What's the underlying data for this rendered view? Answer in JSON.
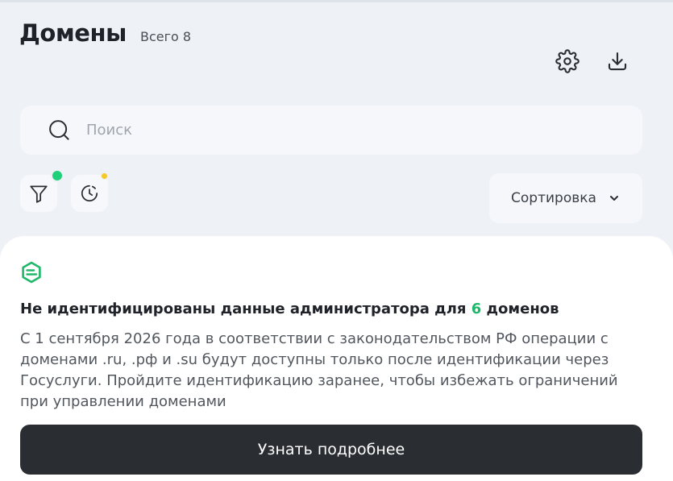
{
  "header": {
    "title": "Домены",
    "total_label": "Всего 8",
    "settings_icon": "gear-icon",
    "download_icon": "download-icon"
  },
  "search": {
    "placeholder": "Поиск",
    "value": "",
    "icon": "search-icon"
  },
  "filters": {
    "filter_icon": "funnel-icon",
    "filter_badge_color": "#1fd07a",
    "history_icon": "clock-history-icon",
    "history_badge_color": "#f6c928"
  },
  "sort": {
    "label": "Сортировка",
    "icon": "chevron-down-icon"
  },
  "notice": {
    "logo": "brand-logo-icon",
    "title_prefix": "Не идентифицированы данные администратора для ",
    "title_count": "6",
    "title_suffix": " доменов",
    "body": "С 1 сентября 2026 года в соответствии с законодательством РФ операции с доменами .ru, .рф и .su будут доступны только после идентификации через Госуслуги. Пройдите идентификацию заранее, чтобы избежать ограничений при управлении доменами",
    "button_label": "Узнать подробнее",
    "accent_color": "#1fb86a"
  }
}
